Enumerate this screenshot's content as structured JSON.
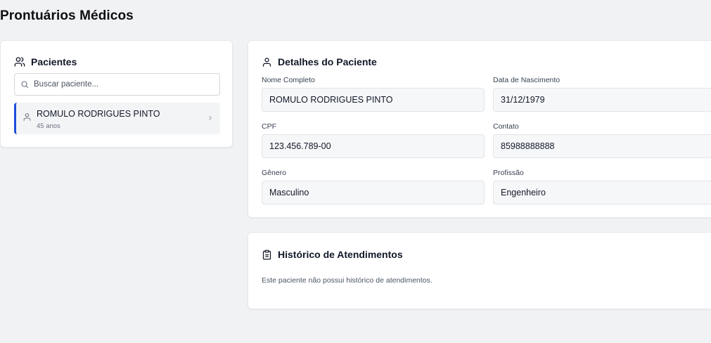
{
  "page": {
    "title": "Prontuários Médicos"
  },
  "patients": {
    "title": "Pacientes",
    "header_icon": "users-icon",
    "search": {
      "placeholder": "Buscar paciente...",
      "value": "",
      "icon": "search-icon"
    },
    "items": [
      {
        "name": "ROMULO RODRIGUES PINTO",
        "age": "45 anos",
        "icon": "user-icon",
        "selected": true
      }
    ]
  },
  "details": {
    "title": "Detalhes do Paciente",
    "header_icon": "user-icon",
    "fields": {
      "nome": {
        "label": "Nome Completo",
        "value": "ROMULO RODRIGUES PINTO"
      },
      "nascimento": {
        "label": "Data de Nascimento",
        "value": "31/12/1979"
      },
      "cpf": {
        "label": "CPF",
        "value": "123.456.789-00"
      },
      "contato": {
        "label": "Contato",
        "value": "85988888888"
      },
      "genero": {
        "label": "Gênero",
        "value": "Masculino"
      },
      "profissao": {
        "label": "Profissão",
        "value": "Engenheiro"
      }
    }
  },
  "history": {
    "title": "Histórico de Atendimentos",
    "header_icon": "clipboard-icon",
    "empty_message": "Este paciente não possui histórico de atendimentos."
  },
  "colors": {
    "accent": "#1d4ed8",
    "background": "#f1f2f4",
    "card": "#ffffff",
    "input_bg": "#f6f7f9"
  }
}
